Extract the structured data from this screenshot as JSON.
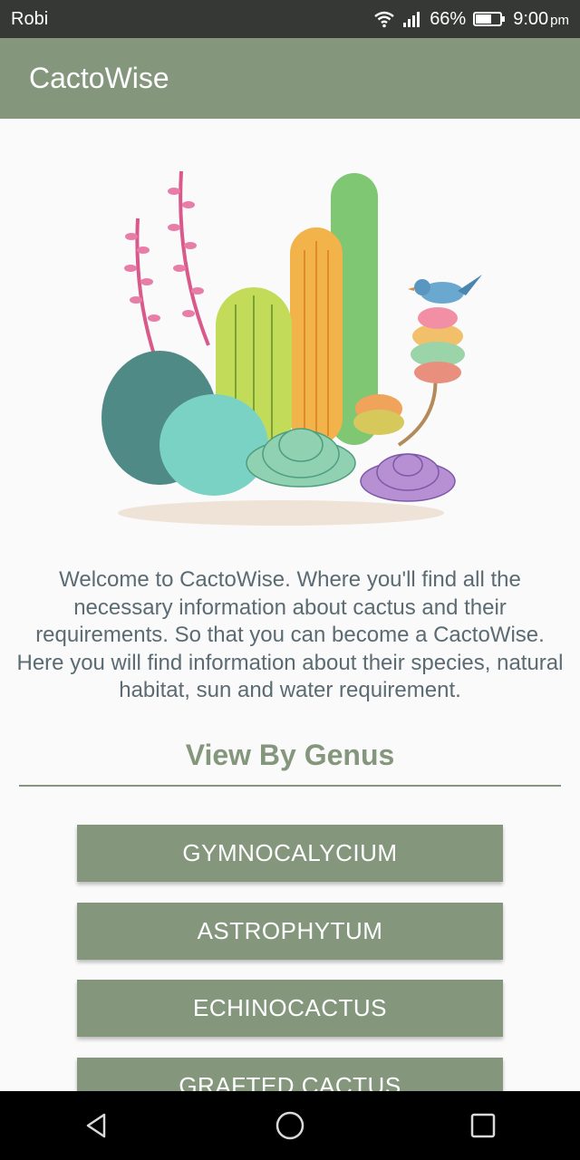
{
  "status_bar": {
    "carrier": "Robi",
    "battery": "66%",
    "time": "9:00",
    "time_suffix": "pm"
  },
  "app_bar": {
    "title": "CactoWise"
  },
  "welcome_text": "Welcome to CactoWise. Where you'll find all the necessary information about cactus and their requirements. So that you can become a CactoWise. Here you will find information about their species, natural habitat, sun and water requirement.",
  "genus_section": {
    "title": "View By Genus",
    "buttons": [
      "GYMNOCALYCIUM",
      "ASTROPHYTUM",
      "ECHINOCACTUS",
      "GRAFTED CACTUS"
    ]
  },
  "colors": {
    "accent": "#84977d",
    "text": "#5b6b73"
  }
}
